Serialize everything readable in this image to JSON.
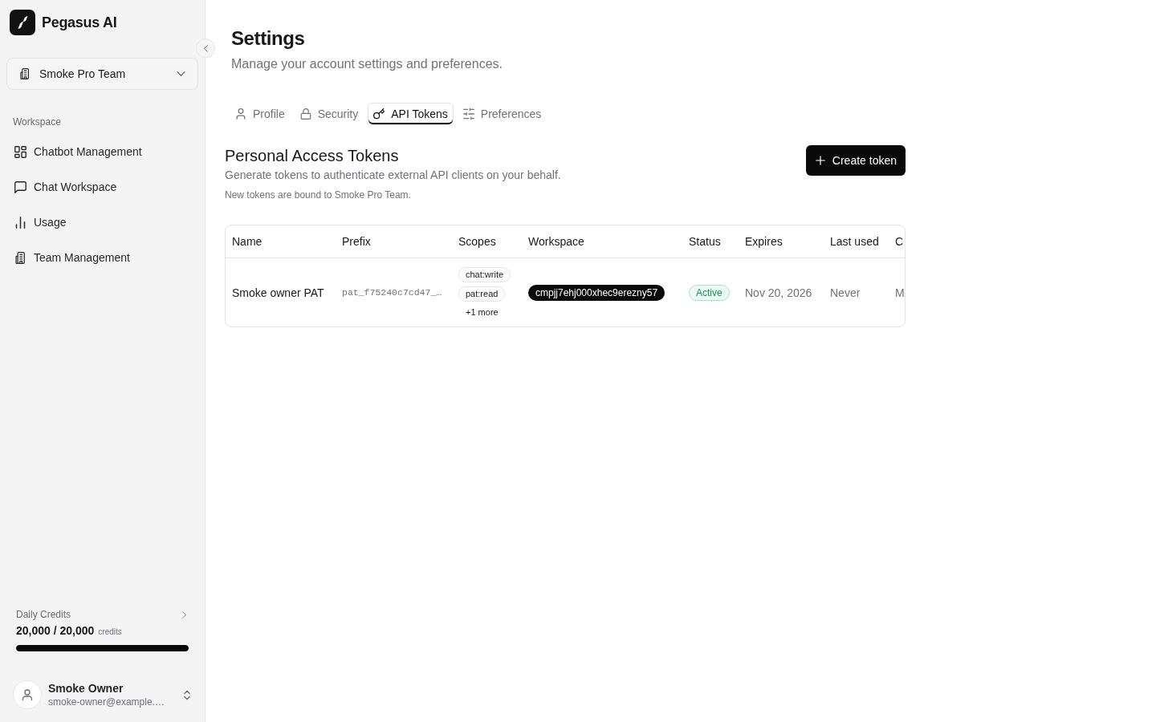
{
  "sidebar": {
    "brand": "Pegasus AI",
    "team_selector": "Smoke Pro Team",
    "section_label": "Workspace",
    "items": [
      {
        "label": "Chatbot Management",
        "selected": false
      },
      {
        "label": "Chat Workspace",
        "selected": false
      },
      {
        "label": "Usage",
        "selected": false
      },
      {
        "label": "Team Management",
        "selected": false
      }
    ],
    "credits": {
      "label": "Daily Credits",
      "value": "20,000 / 20,000",
      "unit": "credits",
      "level": 1
    },
    "user": {
      "name": "Smoke Owner",
      "email": "smoke-owner@example.…"
    }
  },
  "page": {
    "title": "Settings",
    "subtitle": "Manage your account settings and preferences."
  },
  "tabs": [
    {
      "label": "Profile",
      "selected": false
    },
    {
      "label": "Security",
      "selected": false
    },
    {
      "label": "API Tokens",
      "selected": true
    },
    {
      "label": "Preferences",
      "selected": false
    }
  ],
  "tokens_section": {
    "title": "Personal Access Tokens",
    "description": "Generate tokens to authenticate external API clients on your behalf.",
    "note": "New tokens are bound to Smoke Pro Team.",
    "create_button": "Create token",
    "table": {
      "columns": [
        "Name",
        "Prefix",
        "Scopes",
        "Workspace",
        "Status",
        "Expires",
        "Last used",
        "C"
      ],
      "rows": [
        {
          "name": "Smoke owner PAT",
          "prefix": "pat_f75240c7cd47_…",
          "scopes": [
            "chat:write",
            "pat:read"
          ],
          "scopes_more": "+1 more",
          "workspace": "cmpjj7ehj000xhec9erezny57",
          "status": {
            "label": "Active",
            "kind": "active"
          },
          "expires": "Nov 20, 2026",
          "last_used": "Never",
          "column_8": "M"
        }
      ]
    }
  }
}
